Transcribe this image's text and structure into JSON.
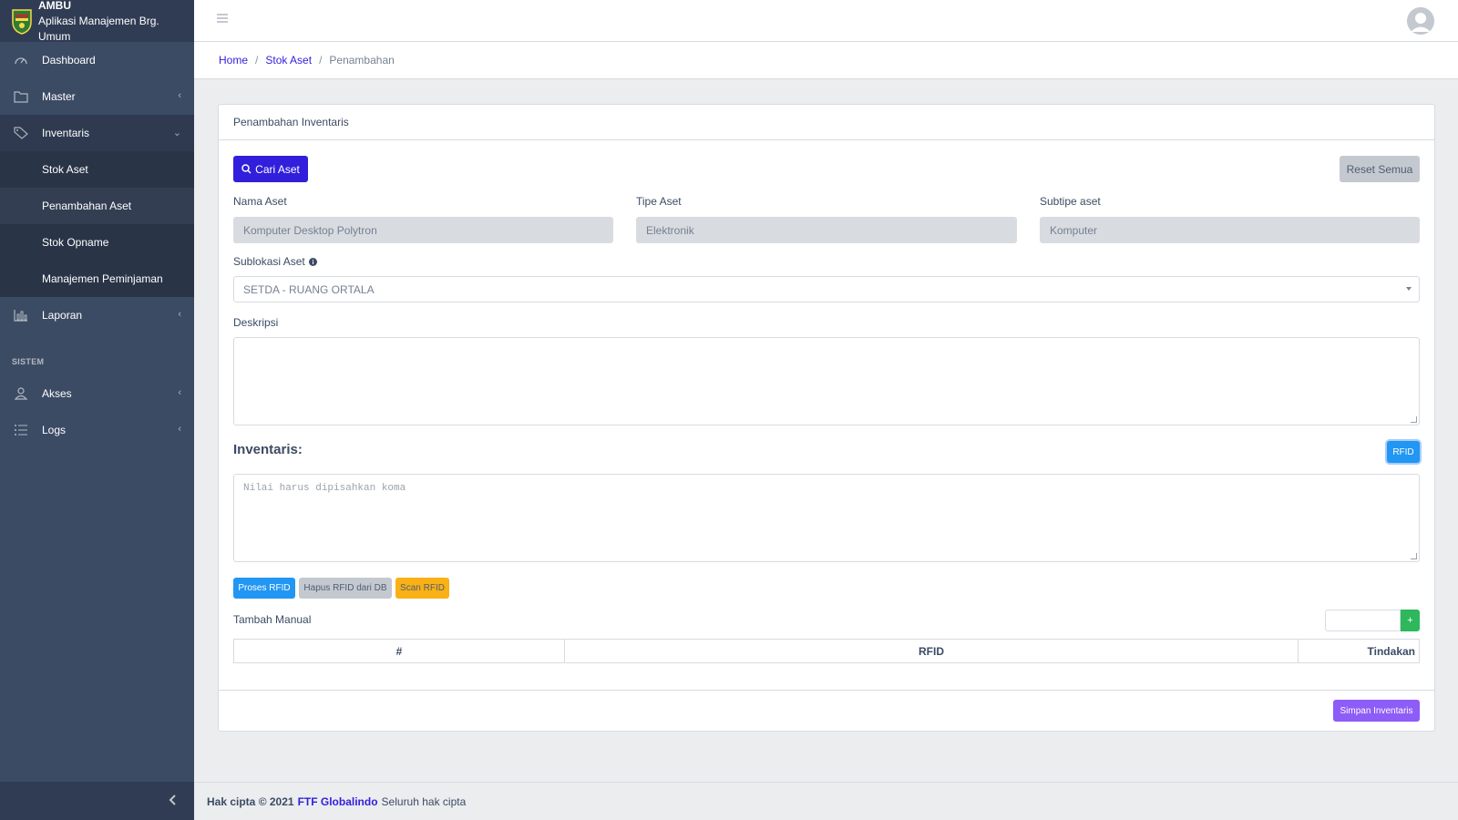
{
  "brand": {
    "title": "AMBU",
    "subtitle": "Aplikasi Manajemen Brg. Umum"
  },
  "sidebar": {
    "items": [
      {
        "label": "Dashboard",
        "icon": "speedometer-icon"
      },
      {
        "label": "Master",
        "icon": "folder-icon"
      },
      {
        "label": "Inventaris",
        "icon": "tag-icon"
      },
      {
        "label": "Laporan",
        "icon": "chart-icon"
      }
    ],
    "subitems": [
      "Stok Aset",
      "Penambahan Aset",
      "Stok Opname",
      "Manajemen Peminjaman"
    ],
    "section_title": "SISTEM",
    "system_items": [
      {
        "label": "Akses",
        "icon": "user-icon"
      },
      {
        "label": "Logs",
        "icon": "list-icon"
      }
    ]
  },
  "breadcrumb": {
    "home": "Home",
    "stok": "Stok Aset",
    "current": "Penambahan"
  },
  "card": {
    "header": "Penambahan Inventaris",
    "cari_label": "Cari Aset",
    "reset_label": "Reset Semua",
    "nama_label": "Nama Aset",
    "nama_value": "Komputer Desktop Polytron",
    "tipe_label": "Tipe Aset",
    "tipe_value": "Elektronik",
    "subtipe_label": "Subtipe aset",
    "subtipe_value": "Komputer",
    "sublokasi_label": "Sublokasi Aset",
    "sublokasi_value": "SETDA - RUANG ORTALA",
    "deskripsi_label": "Deskripsi",
    "inventaris_title": "Inventaris:",
    "rfid_label": "RFID",
    "rfid_placeholder": "Nilai harus dipisahkan koma",
    "proses_label": "Proses RFID",
    "hapus_label": "Hapus RFID dari DB",
    "scan_label": "Scan RFID",
    "manual_label": "Tambah Manual",
    "plus_label": "+",
    "table_headers": [
      "#",
      "RFID",
      "Tindakan"
    ],
    "simpan_label": "Simpan Inventaris"
  },
  "footer": {
    "prefix": "Hak cipta © 2021",
    "company": "FTF Globalindo",
    "suffix": "Seluruh hak cipta"
  },
  "colors": {
    "sidebar": "#3c4b64",
    "primary": "#321fdb",
    "info": "#2196f3",
    "warning": "#f9b115",
    "success": "#2eb85c",
    "purple": "#8e5cf7"
  }
}
